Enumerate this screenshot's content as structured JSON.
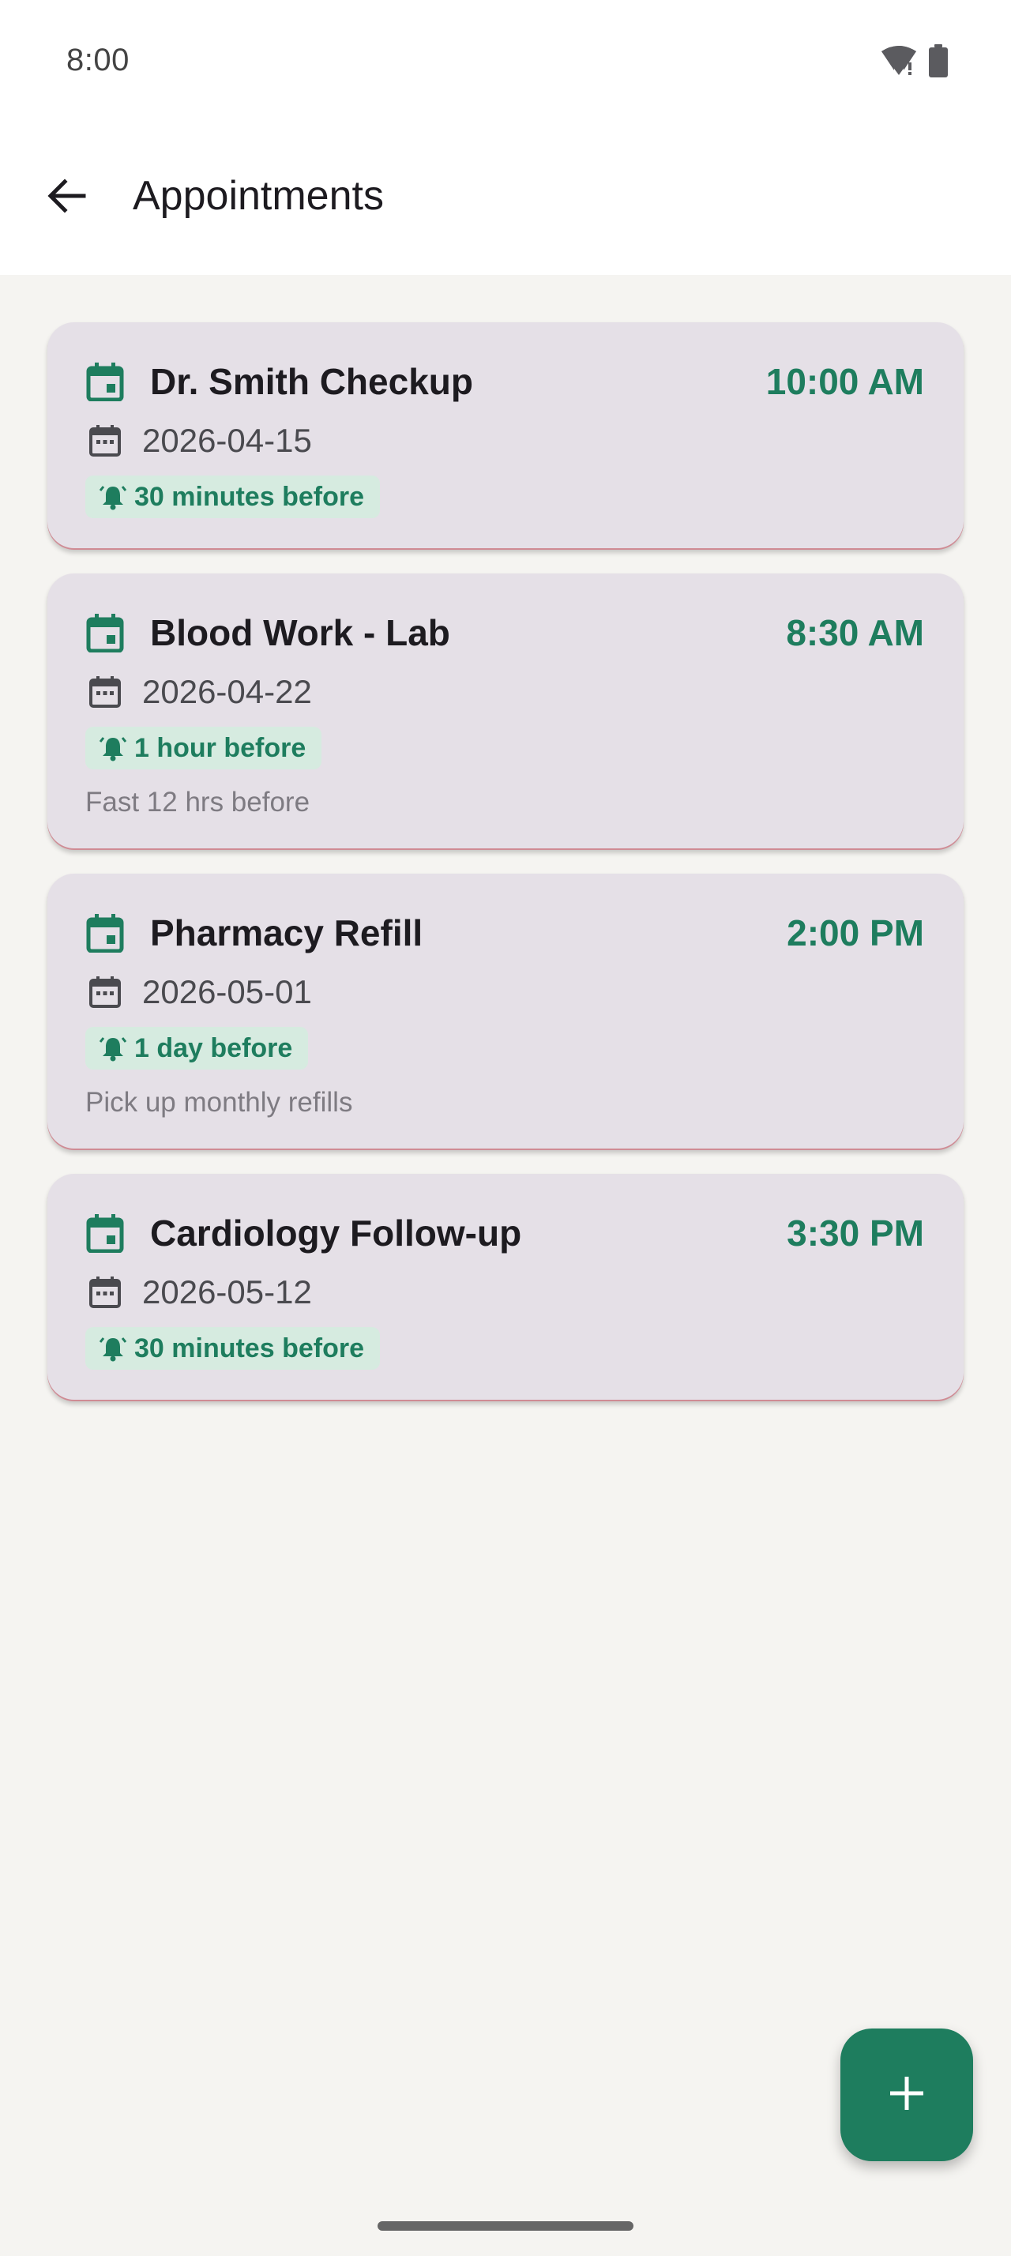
{
  "status_bar": {
    "time": "8:00",
    "icons": [
      "wifi-icon",
      "battery-icon"
    ]
  },
  "app_bar": {
    "title": "Appointments",
    "back_icon": "arrow-back-icon"
  },
  "colors": {
    "accent": "#1e7d5e",
    "card_background": "#e5e0e7",
    "chip_background": "#d6ebe0",
    "page_background": "#f5f4f1"
  },
  "appointments": [
    {
      "title": "Dr. Smith Checkup",
      "time": "10:00 AM",
      "date": "2026-04-15",
      "reminder": "30 minutes before",
      "notes": ""
    },
    {
      "title": "Blood Work - Lab",
      "time": "8:30 AM",
      "date": "2026-04-22",
      "reminder": "1 hour before",
      "notes": "Fast 12 hrs before"
    },
    {
      "title": "Pharmacy Refill",
      "time": "2:00 PM",
      "date": "2026-05-01",
      "reminder": "1 day before",
      "notes": "Pick up monthly refills"
    },
    {
      "title": "Cardiology Follow-up",
      "time": "3:30 PM",
      "date": "2026-05-12",
      "reminder": "30 minutes before",
      "notes": ""
    }
  ],
  "fab": {
    "icon": "plus-icon"
  }
}
